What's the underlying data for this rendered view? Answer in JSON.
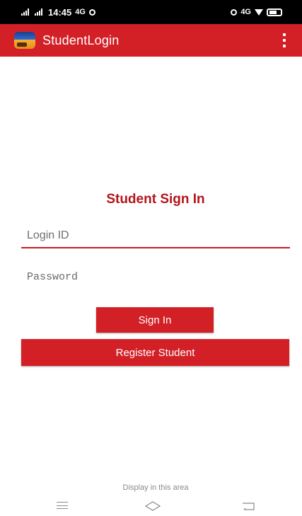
{
  "status_bar": {
    "time": "14:45",
    "network_left": "4G",
    "network_right": "4G"
  },
  "app_bar": {
    "title": "StudentLogin",
    "icon": "app-logo-icon",
    "menu_icon": "overflow-menu-icon"
  },
  "form": {
    "heading": "Student Sign In",
    "login_placeholder": "Login ID",
    "login_value": "",
    "password_placeholder": "Password",
    "password_value": "",
    "signin_label": "Sign In",
    "register_label": "Register Student"
  },
  "footer": {
    "ad_text": "Display in this area"
  },
  "nav_bar": {
    "recents": "menu-icon",
    "home": "home-icon",
    "back": "back-icon"
  },
  "colors": {
    "primary": "#d32027",
    "heading": "#b3151c",
    "status_bar": "#000000"
  }
}
